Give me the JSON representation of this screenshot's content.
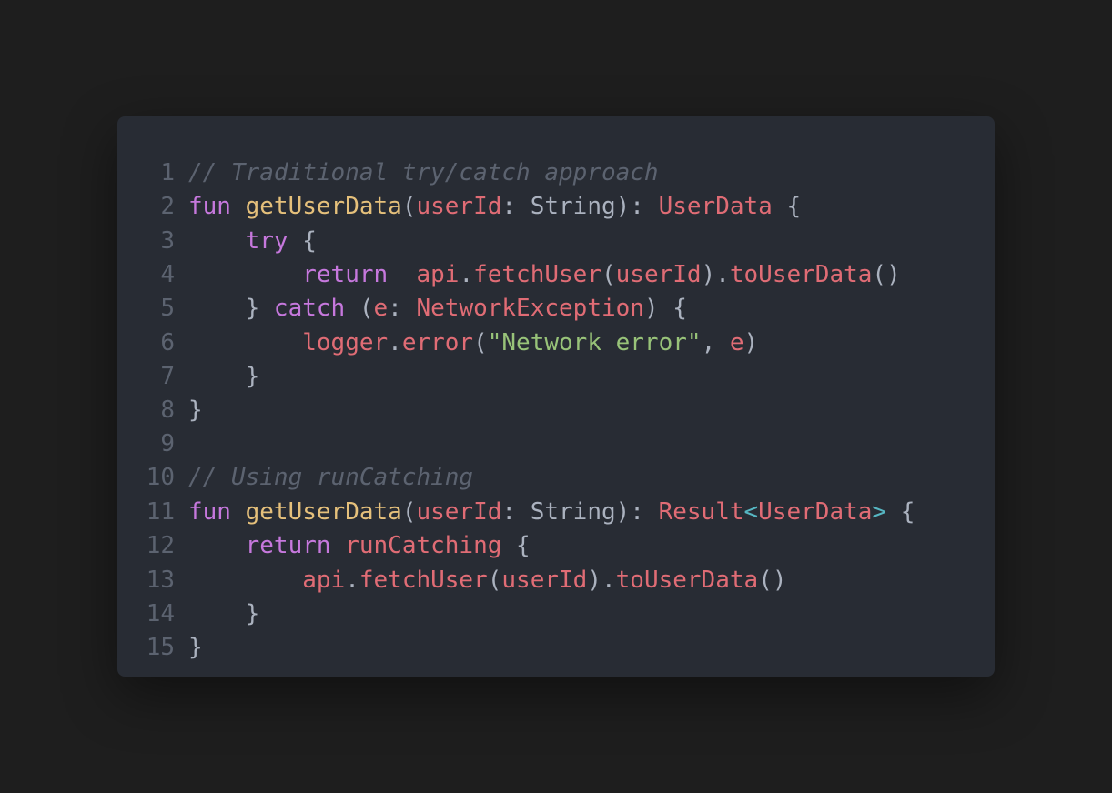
{
  "code": {
    "lines": [
      {
        "n": "1",
        "tokens": [
          [
            "c",
            "// Traditional try/catch approach"
          ]
        ]
      },
      {
        "n": "2",
        "tokens": [
          [
            "k",
            "fun "
          ],
          [
            "f",
            "getUserData"
          ],
          [
            "p",
            "("
          ],
          [
            "v",
            "userId"
          ],
          [
            "p",
            ": "
          ],
          [
            "w",
            "String"
          ],
          [
            "p",
            "): "
          ],
          [
            "t",
            "UserData"
          ],
          [
            "p",
            " {"
          ]
        ]
      },
      {
        "n": "3",
        "tokens": [
          [
            "p",
            "    "
          ],
          [
            "k",
            "try"
          ],
          [
            "p",
            " {"
          ]
        ]
      },
      {
        "n": "4",
        "tokens": [
          [
            "p",
            "        "
          ],
          [
            "k",
            "return"
          ],
          [
            "p",
            "  "
          ],
          [
            "v",
            "api"
          ],
          [
            "p",
            "."
          ],
          [
            "v",
            "fetchUser"
          ],
          [
            "p",
            "("
          ],
          [
            "v",
            "userId"
          ],
          [
            "p",
            ")."
          ],
          [
            "v",
            "toUserData"
          ],
          [
            "p",
            "()"
          ]
        ]
      },
      {
        "n": "5",
        "tokens": [
          [
            "p",
            "    } "
          ],
          [
            "k",
            "catch"
          ],
          [
            "p",
            " ("
          ],
          [
            "v",
            "e"
          ],
          [
            "p",
            ": "
          ],
          [
            "t",
            "NetworkException"
          ],
          [
            "p",
            ") {"
          ]
        ]
      },
      {
        "n": "6",
        "tokens": [
          [
            "p",
            "        "
          ],
          [
            "v",
            "logger"
          ],
          [
            "p",
            "."
          ],
          [
            "v",
            "error"
          ],
          [
            "p",
            "("
          ],
          [
            "s",
            "\"Network error\""
          ],
          [
            "p",
            ", "
          ],
          [
            "v",
            "e"
          ],
          [
            "p",
            ")"
          ]
        ]
      },
      {
        "n": "7",
        "tokens": [
          [
            "p",
            "    }"
          ]
        ]
      },
      {
        "n": "8",
        "tokens": [
          [
            "p",
            "}"
          ]
        ]
      },
      {
        "n": "9",
        "tokens": []
      },
      {
        "n": "10",
        "tokens": [
          [
            "c",
            "// Using runCatching"
          ]
        ]
      },
      {
        "n": "11",
        "tokens": [
          [
            "k",
            "fun "
          ],
          [
            "f",
            "getUserData"
          ],
          [
            "p",
            "("
          ],
          [
            "v",
            "userId"
          ],
          [
            "p",
            ": "
          ],
          [
            "w",
            "String"
          ],
          [
            "p",
            "): "
          ],
          [
            "t",
            "Result"
          ],
          [
            "o",
            "<"
          ],
          [
            "t",
            "UserData"
          ],
          [
            "o",
            ">"
          ],
          [
            "p",
            " {"
          ]
        ]
      },
      {
        "n": "12",
        "tokens": [
          [
            "p",
            "    "
          ],
          [
            "k",
            "return "
          ],
          [
            "v",
            "runCatching"
          ],
          [
            "p",
            " {"
          ]
        ]
      },
      {
        "n": "13",
        "tokens": [
          [
            "p",
            "        "
          ],
          [
            "v",
            "api"
          ],
          [
            "p",
            "."
          ],
          [
            "v",
            "fetchUser"
          ],
          [
            "p",
            "("
          ],
          [
            "v",
            "userId"
          ],
          [
            "p",
            ")."
          ],
          [
            "v",
            "toUserData"
          ],
          [
            "p",
            "()"
          ]
        ]
      },
      {
        "n": "14",
        "tokens": [
          [
            "p",
            "    }"
          ]
        ]
      },
      {
        "n": "15",
        "tokens": [
          [
            "p",
            "}"
          ]
        ]
      }
    ]
  }
}
